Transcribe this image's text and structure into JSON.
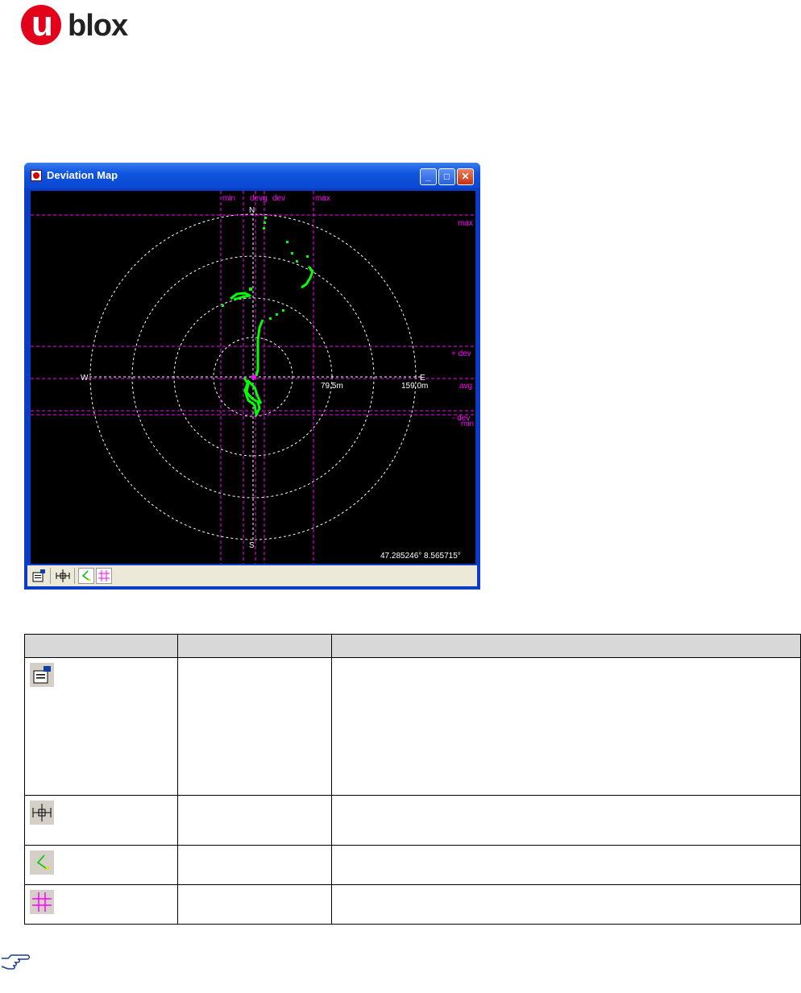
{
  "logo": {
    "letter": "u",
    "rest": "blox",
    "brand_color": "#e2001a"
  },
  "window": {
    "title": "Deviation Map",
    "controls": {
      "minimize": "_",
      "maximize": "□",
      "close": "✕"
    }
  },
  "map": {
    "compass": {
      "north": "N",
      "south": "S",
      "west": "W",
      "east": "E"
    },
    "ring_labels": [
      "79.5m",
      "159.0m"
    ],
    "top_labels": {
      "min": "min",
      "dev_minus": "dev",
      "dev_plus": "dev",
      "avg": "g",
      "max": "max"
    },
    "right_labels": {
      "max": "max",
      "plus_dev": "+ dev",
      "avg": "avg",
      "minus_dev": "- dev",
      "min": "min"
    },
    "coordinates": "47.285246° 8.565715°",
    "colors": {
      "background": "#000000",
      "rings": "#ffffff",
      "lines": "#ff00ff",
      "track": "#00ff00"
    }
  },
  "toolbar": {
    "items": [
      "settings-icon",
      "center-move-icon",
      "track-icon",
      "grid-icon"
    ]
  },
  "table": {
    "headers": [
      "",
      "",
      ""
    ],
    "rows": [
      {
        "icon": "settings-icon",
        "name": "",
        "description": ""
      },
      {
        "icon": "center-move-icon",
        "name": "",
        "description": ""
      },
      {
        "icon": "track-icon",
        "name": "",
        "description": ""
      },
      {
        "icon": "grid-icon",
        "name": "",
        "description": ""
      }
    ]
  },
  "note": {
    "icon": "pointing-hand-icon"
  }
}
